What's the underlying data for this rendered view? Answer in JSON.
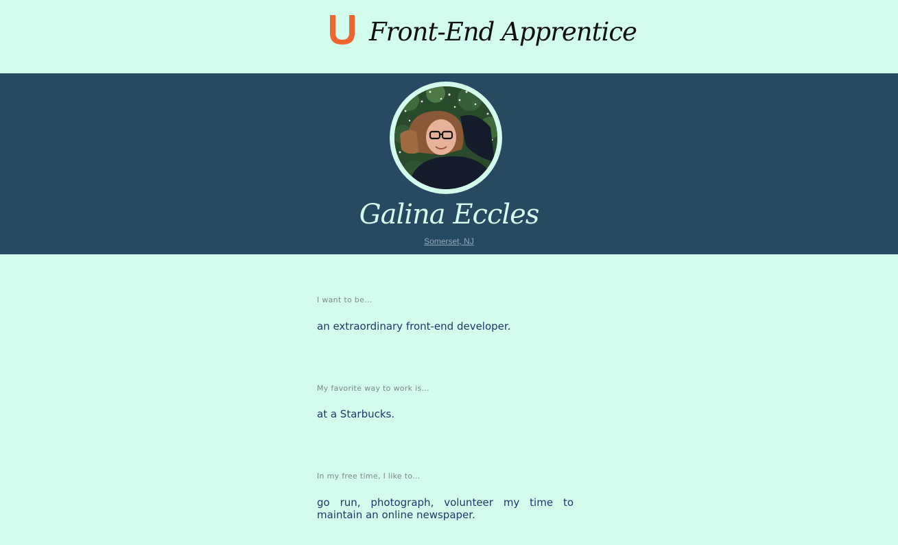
{
  "header": {
    "logo_letter": "U",
    "title": "Front-End Apprentice",
    "logo_color": "#f0652f"
  },
  "profile": {
    "name": "Galina Eccles",
    "location": "Somerset, NJ",
    "band_color": "#264a61"
  },
  "questions": [
    {
      "label": "I want to be...",
      "answer": "an extraordinary front-end developer."
    },
    {
      "label": "My favorite way to work is...",
      "answer": "at a Starbucks."
    },
    {
      "label": "In my free time, I like to...",
      "answer": "go run, photograph, volunteer my time to maintain an online newspaper."
    }
  ],
  "colors": {
    "background": "#d2fcec",
    "answer_text": "#1a3a6b",
    "label_text": "#7c8b86"
  }
}
